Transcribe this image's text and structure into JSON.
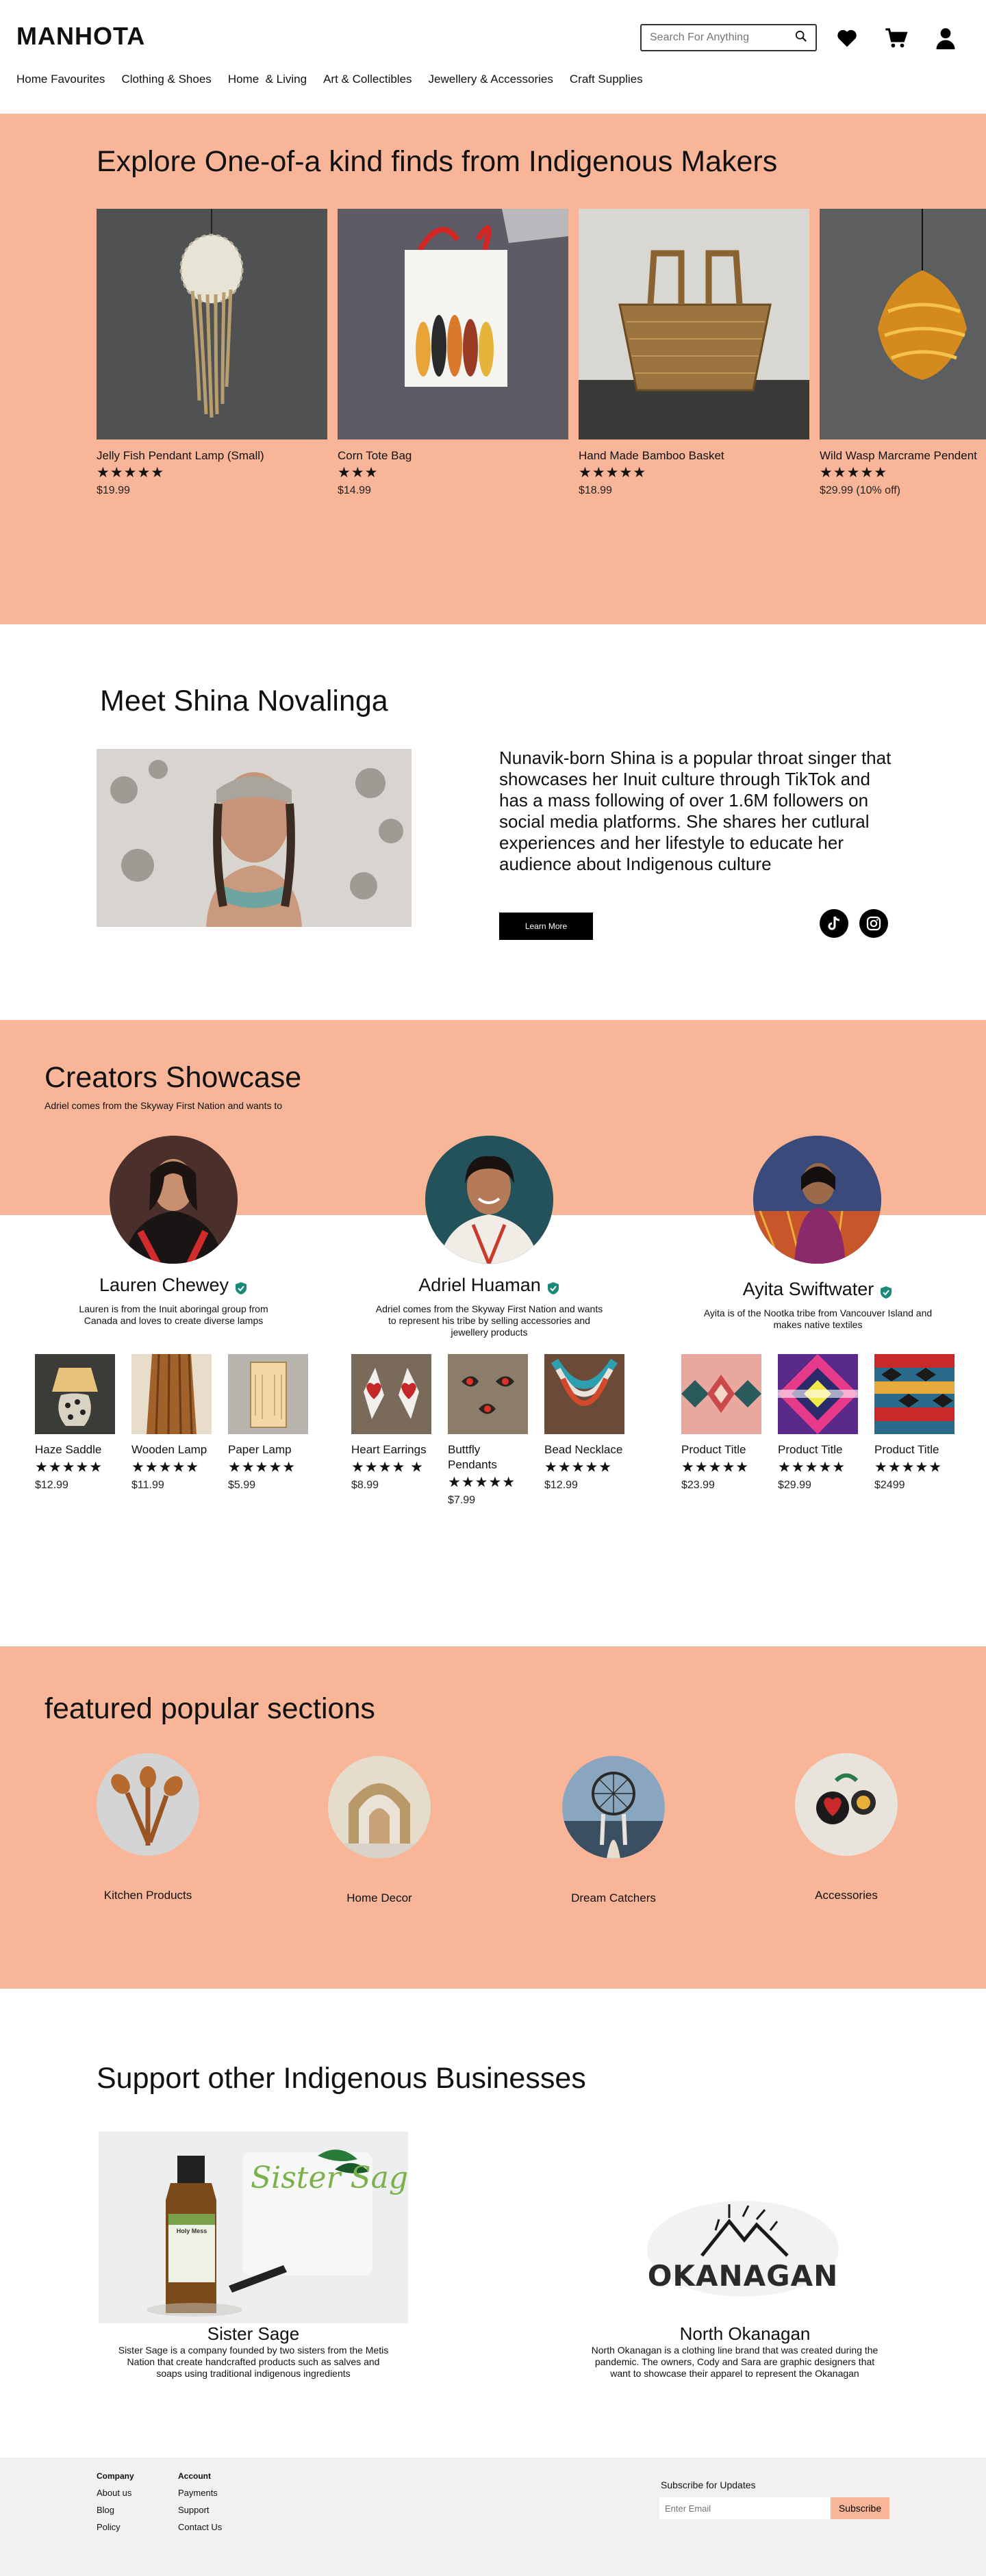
{
  "header": {
    "logo": "MANHOTA",
    "search_placeholder": "Search For Anything",
    "nav": [
      "Home Favourites",
      "Clothing & Shoes",
      "Home  & Living",
      "Art & Collectibles",
      "Jewellery & Accessories",
      "Craft Supplies"
    ]
  },
  "explore": {
    "title": "Explore One-of-a kind finds from Indigenous Makers",
    "products": [
      {
        "title": "Jelly Fish Pendant Lamp (Small)",
        "stars": "★★★★★",
        "price": "$19.99"
      },
      {
        "title": "Corn Tote Bag",
        "stars": "★★★",
        "price": "$14.99"
      },
      {
        "title": "Hand Made Bamboo Basket",
        "stars": "★★★★★",
        "price": "$18.99"
      },
      {
        "title": "Wild Wasp Marcrame Pendent",
        "stars": "★★★★★",
        "price": "$29.99 (10% off)"
      }
    ]
  },
  "meet": {
    "title": "Meet Shina Novalinga",
    "bio": "Nunavik-born Shina is a popular throat singer that showcases her Inuit culture through TikTok and has a mass following of over 1.6M followers on social media platforms. She shares her cutlural experiences and her lifestyle to educate her audience about Indigenous culture",
    "button": "Learn More"
  },
  "creators": {
    "title": "Creators Showcase",
    "subtitle": "Adriel comes from the Skyway First Nation and wants to",
    "list": [
      {
        "name": "Lauren Chewey",
        "desc": "Lauren is from the Inuit aboringal group from Canada and loves to create diverse lamps",
        "products": [
          {
            "title": "Haze Saddle",
            "stars": "★★★★★",
            "price": "$12.99"
          },
          {
            "title": "Wooden Lamp",
            "stars": "★★★★★",
            "price": "$11.99"
          },
          {
            "title": "Paper Lamp",
            "stars": "★★★★★",
            "price": "$5.99"
          }
        ]
      },
      {
        "name": "Adriel Huaman",
        "desc": "Adriel comes from the Skyway First Nation and wants to represent his tribe by selling accessories and jewellery products",
        "products": [
          {
            "title": "Heart Earrings",
            "stars": "★★★★ ★",
            "price": "$8.99"
          },
          {
            "title": "Buttfly Pendants",
            "stars": "★★★★★",
            "price": "$7.99"
          },
          {
            "title": "Bead Necklace",
            "stars": "★★★★★",
            "price": "$12.99"
          }
        ]
      },
      {
        "name": "Ayita Swiftwater",
        "desc": "Ayita is of the Nootka tribe from Vancouver Island and makes native textiles",
        "products": [
          {
            "title": "Product Title",
            "stars": "★★★★★",
            "price": "$23.99"
          },
          {
            "title": "Product Title",
            "stars": "★★★★★",
            "price": "$29.99"
          },
          {
            "title": "Product Title",
            "stars": "★★★★★",
            "price": "$2499"
          }
        ]
      }
    ]
  },
  "featured": {
    "title": "featured popular sections",
    "categories": [
      "Kitchen Products",
      "Home Decor",
      "Dream Catchers",
      "Accessories"
    ]
  },
  "support": {
    "title": "Support other Indigenous Businesses",
    "businesses": [
      {
        "name": "Sister Sage",
        "logo_text": "Sister Sage",
        "label_text": "Holy Mess",
        "desc": "Sister Sage is a company founded by two sisters from the Metis Nation that create handcrafted products such as salves and soaps using traditional indigenous ingredients"
      },
      {
        "name": "North Okanagan",
        "logo_text": "OKANAGAN",
        "desc": "North Okanagan is a clothing line brand that was created during the pandemic. The owners, Cody and Sara are graphic designers that want to showcase their apparel to represent the Okanagan"
      }
    ]
  },
  "footer": {
    "company": {
      "heading": "Company",
      "links": [
        "About us",
        "Blog",
        "Policy"
      ]
    },
    "account": {
      "heading": "Account",
      "links": [
        "Payments",
        "Support",
        "Contact Us"
      ]
    },
    "subscribe": {
      "label": "Subscribe for Updates",
      "placeholder": "Enter Email",
      "button": "Subscribe"
    }
  },
  "colors": {
    "accent": "#f8b598",
    "footer_bg": "#f2f1f1",
    "verified": "#1c8a7a"
  },
  "icons": [
    "search-icon",
    "heart-icon",
    "cart-icon",
    "user-icon",
    "tiktok-icon",
    "instagram-icon",
    "verified-icon"
  ]
}
